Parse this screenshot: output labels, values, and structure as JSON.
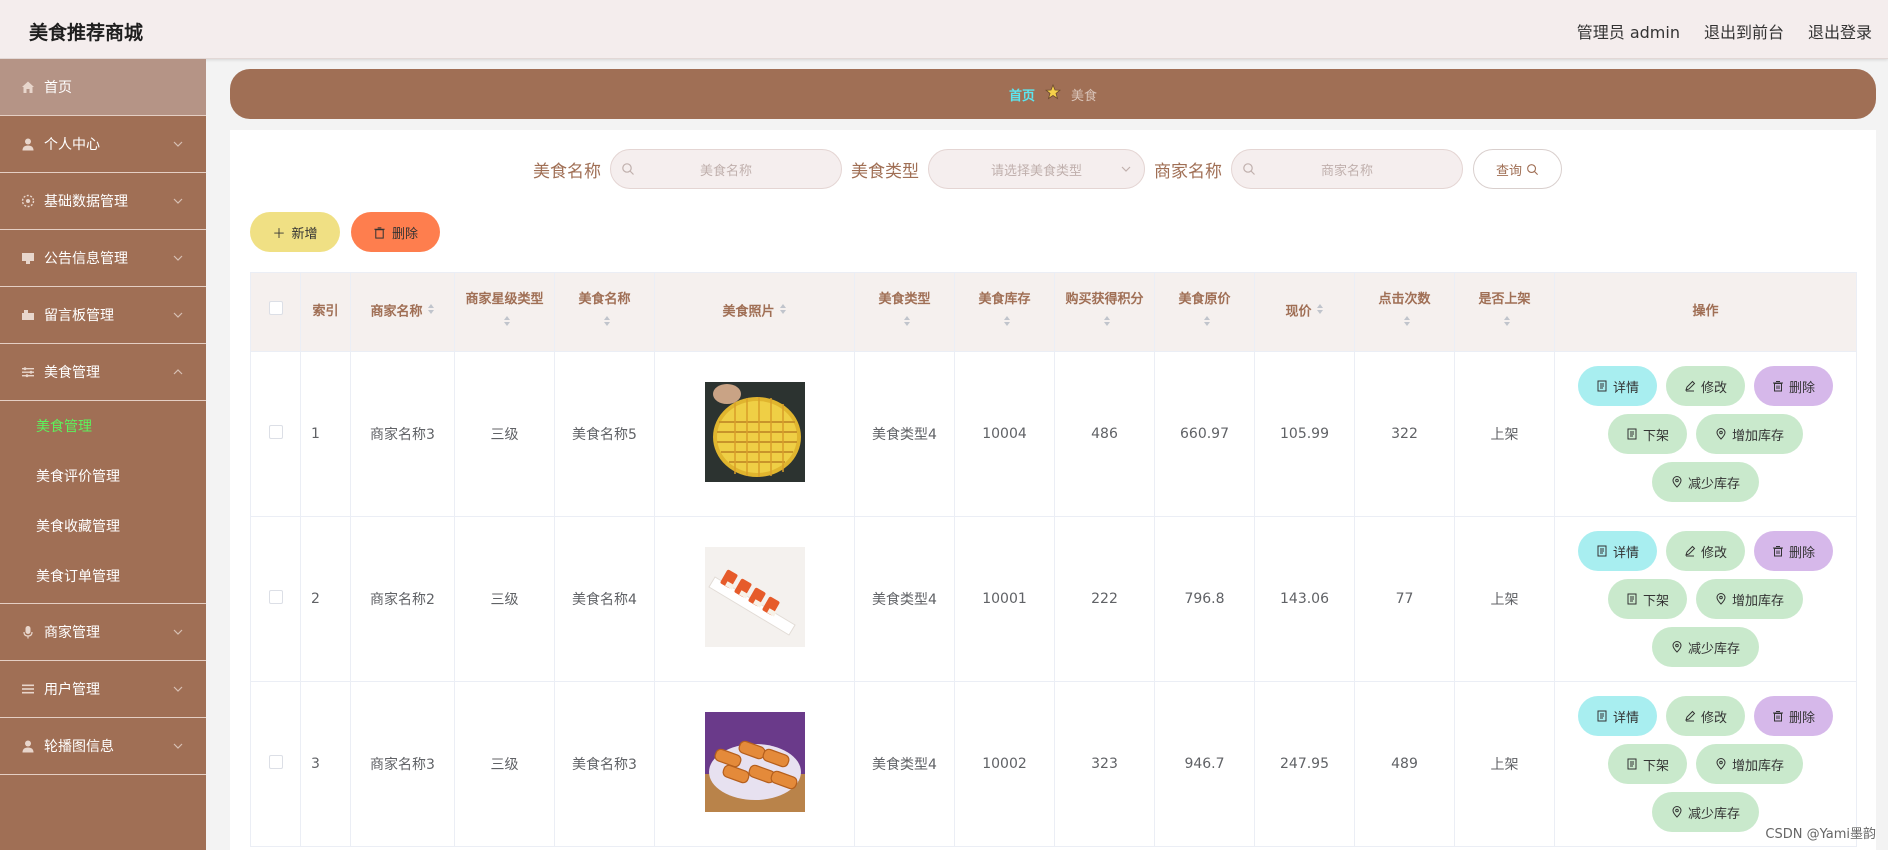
{
  "app": {
    "title": "美食推荐商城"
  },
  "header": {
    "admin_label": "管理员 admin",
    "front_label": "退出到前台",
    "logout_label": "退出登录"
  },
  "sidebar": {
    "items": [
      {
        "label": "首页",
        "icon": "home-icon"
      },
      {
        "label": "个人中心",
        "icon": "user-icon"
      },
      {
        "label": "基础数据管理",
        "icon": "settings-icon"
      },
      {
        "label": "公告信息管理",
        "icon": "notice-icon"
      },
      {
        "label": "留言板管理",
        "icon": "message-icon"
      },
      {
        "label": "美食管理",
        "icon": "food-icon"
      },
      {
        "label": "商家管理",
        "icon": "shop-icon"
      },
      {
        "label": "用户管理",
        "icon": "users-icon"
      },
      {
        "label": "轮播图信息",
        "icon": "image-icon"
      }
    ],
    "sub_items": [
      "美食管理",
      "美食评价管理",
      "美食收藏管理",
      "美食订单管理"
    ]
  },
  "breadcrumb": {
    "home": "首页",
    "current": "美食"
  },
  "search": {
    "food_name_label": "美食名称",
    "food_name_placeholder": "美食名称",
    "food_type_label": "美食类型",
    "food_type_placeholder": "请选择美食类型",
    "shop_name_label": "商家名称",
    "shop_name_placeholder": "商家名称",
    "query_label": "查询"
  },
  "actions": {
    "add_label": "新增",
    "delete_label": "删除"
  },
  "table": {
    "headers": {
      "index": "索引",
      "shop_name": "商家名称",
      "shop_star": "商家星级类型",
      "food_name": "美食名称",
      "photo": "美食照片",
      "food_type": "美食类型",
      "stock": "美食库存",
      "points": "购买获得积分",
      "orig_price": "美食原价",
      "price": "现价",
      "clicks": "点击次数",
      "on_shelf": "是否上架",
      "ops": "操作"
    },
    "op_labels": {
      "detail": "详情",
      "edit": "修改",
      "delete": "删除",
      "off_shelf": "下架",
      "inc_stock": "增加库存",
      "dec_stock": "减少库存"
    },
    "rows": [
      {
        "index": "1",
        "shop_name": "商家名称3",
        "shop_star": "三级",
        "food_name": "美食名称5",
        "food_type": "美食类型4",
        "stock": "10004",
        "points": "486",
        "orig_price": "660.97",
        "price": "105.99",
        "clicks": "322",
        "on_shelf": "上架"
      },
      {
        "index": "2",
        "shop_name": "商家名称2",
        "shop_star": "三级",
        "food_name": "美食名称4",
        "food_type": "美食类型4",
        "stock": "10001",
        "points": "222",
        "orig_price": "796.8",
        "price": "143.06",
        "clicks": "77",
        "on_shelf": "上架"
      },
      {
        "index": "3",
        "shop_name": "商家名称3",
        "shop_star": "三级",
        "food_name": "美食名称3",
        "food_type": "美食类型4",
        "stock": "10002",
        "points": "323",
        "orig_price": "946.7",
        "price": "247.95",
        "clicks": "489",
        "on_shelf": "上架"
      }
    ]
  },
  "watermark": "CSDN @Yami墨韵",
  "colors": {
    "brand": "#a06f55",
    "active_sub": "#5cf35c",
    "breadcrumb_home": "#5ce6f0"
  }
}
